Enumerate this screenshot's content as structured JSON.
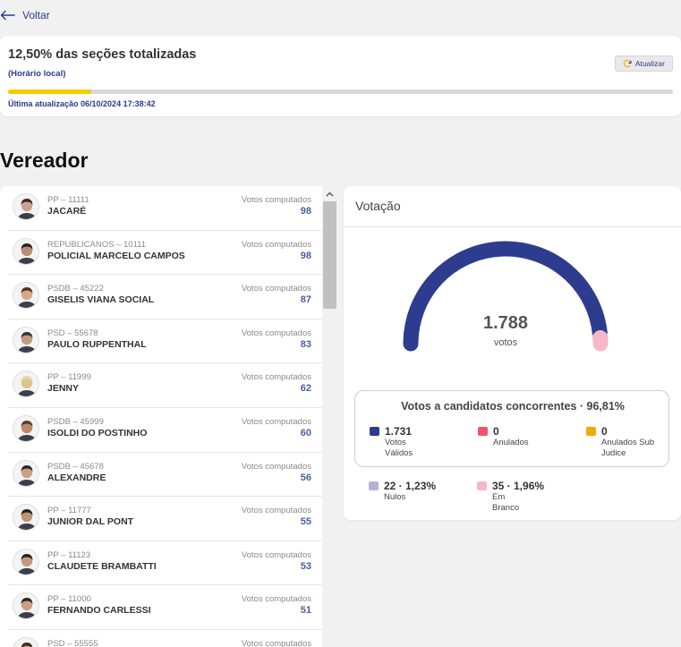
{
  "nav": {
    "back_label": "Voltar"
  },
  "progress": {
    "title": "12,50% das seções totalizadas",
    "subtitle": "(Horário local)",
    "refresh_label": "Atualizar",
    "fraction": 0.125,
    "last_update": "Última atualização 06/10/2024 17:38:42",
    "bar_color": "#f5cc00"
  },
  "section": {
    "title": "Vereador"
  },
  "candidates": {
    "votes_label": "Votos computados",
    "items": [
      {
        "party": "PP – 11111",
        "name": "JACARÉ",
        "votes": "98"
      },
      {
        "party": "REPUBLICANOS – 10111",
        "name": "POLICIAL MARCELO CAMPOS",
        "votes": "98"
      },
      {
        "party": "PSDB – 45222",
        "name": "GISELIS VIANA SOCIAL",
        "votes": "87"
      },
      {
        "party": "PSD – 55678",
        "name": "PAULO RUPPENTHAL",
        "votes": "83"
      },
      {
        "party": "PP – 11999",
        "name": "JENNY",
        "votes": "62"
      },
      {
        "party": "PSDB – 45999",
        "name": "ISOLDI DO POSTINHO",
        "votes": "60"
      },
      {
        "party": "PSDB – 45678",
        "name": "ALEXANDRE",
        "votes": "56"
      },
      {
        "party": "PP – 11777",
        "name": "JUNIOR DAL PONT",
        "votes": "55"
      },
      {
        "party": "PP – 11123",
        "name": "CLAUDETE BRAMBATTI",
        "votes": "53"
      },
      {
        "party": "PP – 11000",
        "name": "FERNANDO CARLESSI",
        "votes": "51"
      },
      {
        "party": "PSD – 55555",
        "name": "",
        "votes": ""
      }
    ]
  },
  "votacao": {
    "title": "Votação",
    "total": "1.788",
    "total_label": "votos",
    "concorrentes_title": "Votos a candidatos concorrentes · 96,81%",
    "legend": [
      {
        "value": "1.731",
        "label": "Votos Válidos",
        "color": "#2e3c8f",
        "count": 1731
      },
      {
        "value": "0",
        "label": "Anulados",
        "color": "#f2536a",
        "count": 0
      },
      {
        "value": "0",
        "label": "Anulados Sub Judice",
        "color": "#f5a800",
        "count": 0
      },
      {
        "value": "22 · 1,23%",
        "label": "Nulos",
        "color": "#b7b0d6",
        "count": 22
      },
      {
        "value": "35 · 1,96%",
        "label": "Em Branco",
        "color": "#f6b8c4",
        "count": 35
      }
    ]
  }
}
